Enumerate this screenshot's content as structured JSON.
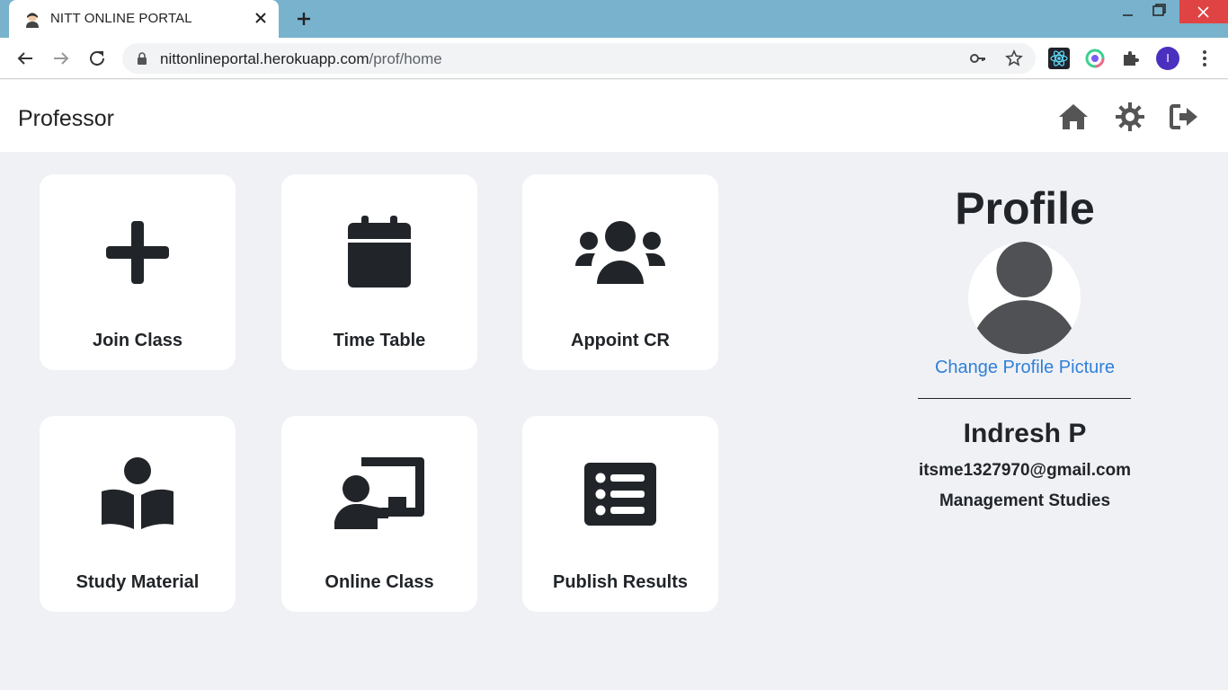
{
  "browser": {
    "tab_title": "NITT ONLINE PORTAL",
    "url_host": "nittonlineportal.herokuapp.com",
    "url_path": "/prof/home",
    "profile_initial": "I"
  },
  "header": {
    "title": "Professor",
    "icons": [
      "home-icon",
      "settings-gear-icon",
      "logout-icon"
    ]
  },
  "cards": [
    {
      "label": "Join Class",
      "icon": "plus-icon"
    },
    {
      "label": "Time Table",
      "icon": "calendar-icon"
    },
    {
      "label": "Appoint CR",
      "icon": "users-icon"
    },
    {
      "label": "Study Material",
      "icon": "book-reader-icon"
    },
    {
      "label": "Online Class",
      "icon": "chalkboard-teacher-icon"
    },
    {
      "label": "Publish Results",
      "icon": "list-icon"
    }
  ],
  "profile": {
    "title": "Profile",
    "change_picture": "Change Profile Picture",
    "name": "Indresh P",
    "email": "itsme1327970@gmail.com",
    "department": "Management Studies"
  },
  "colors": {
    "page_bg": "#f0f1f5",
    "tabbar": "#79b2cc",
    "link": "#2f7fd9",
    "icon": "#212529"
  }
}
